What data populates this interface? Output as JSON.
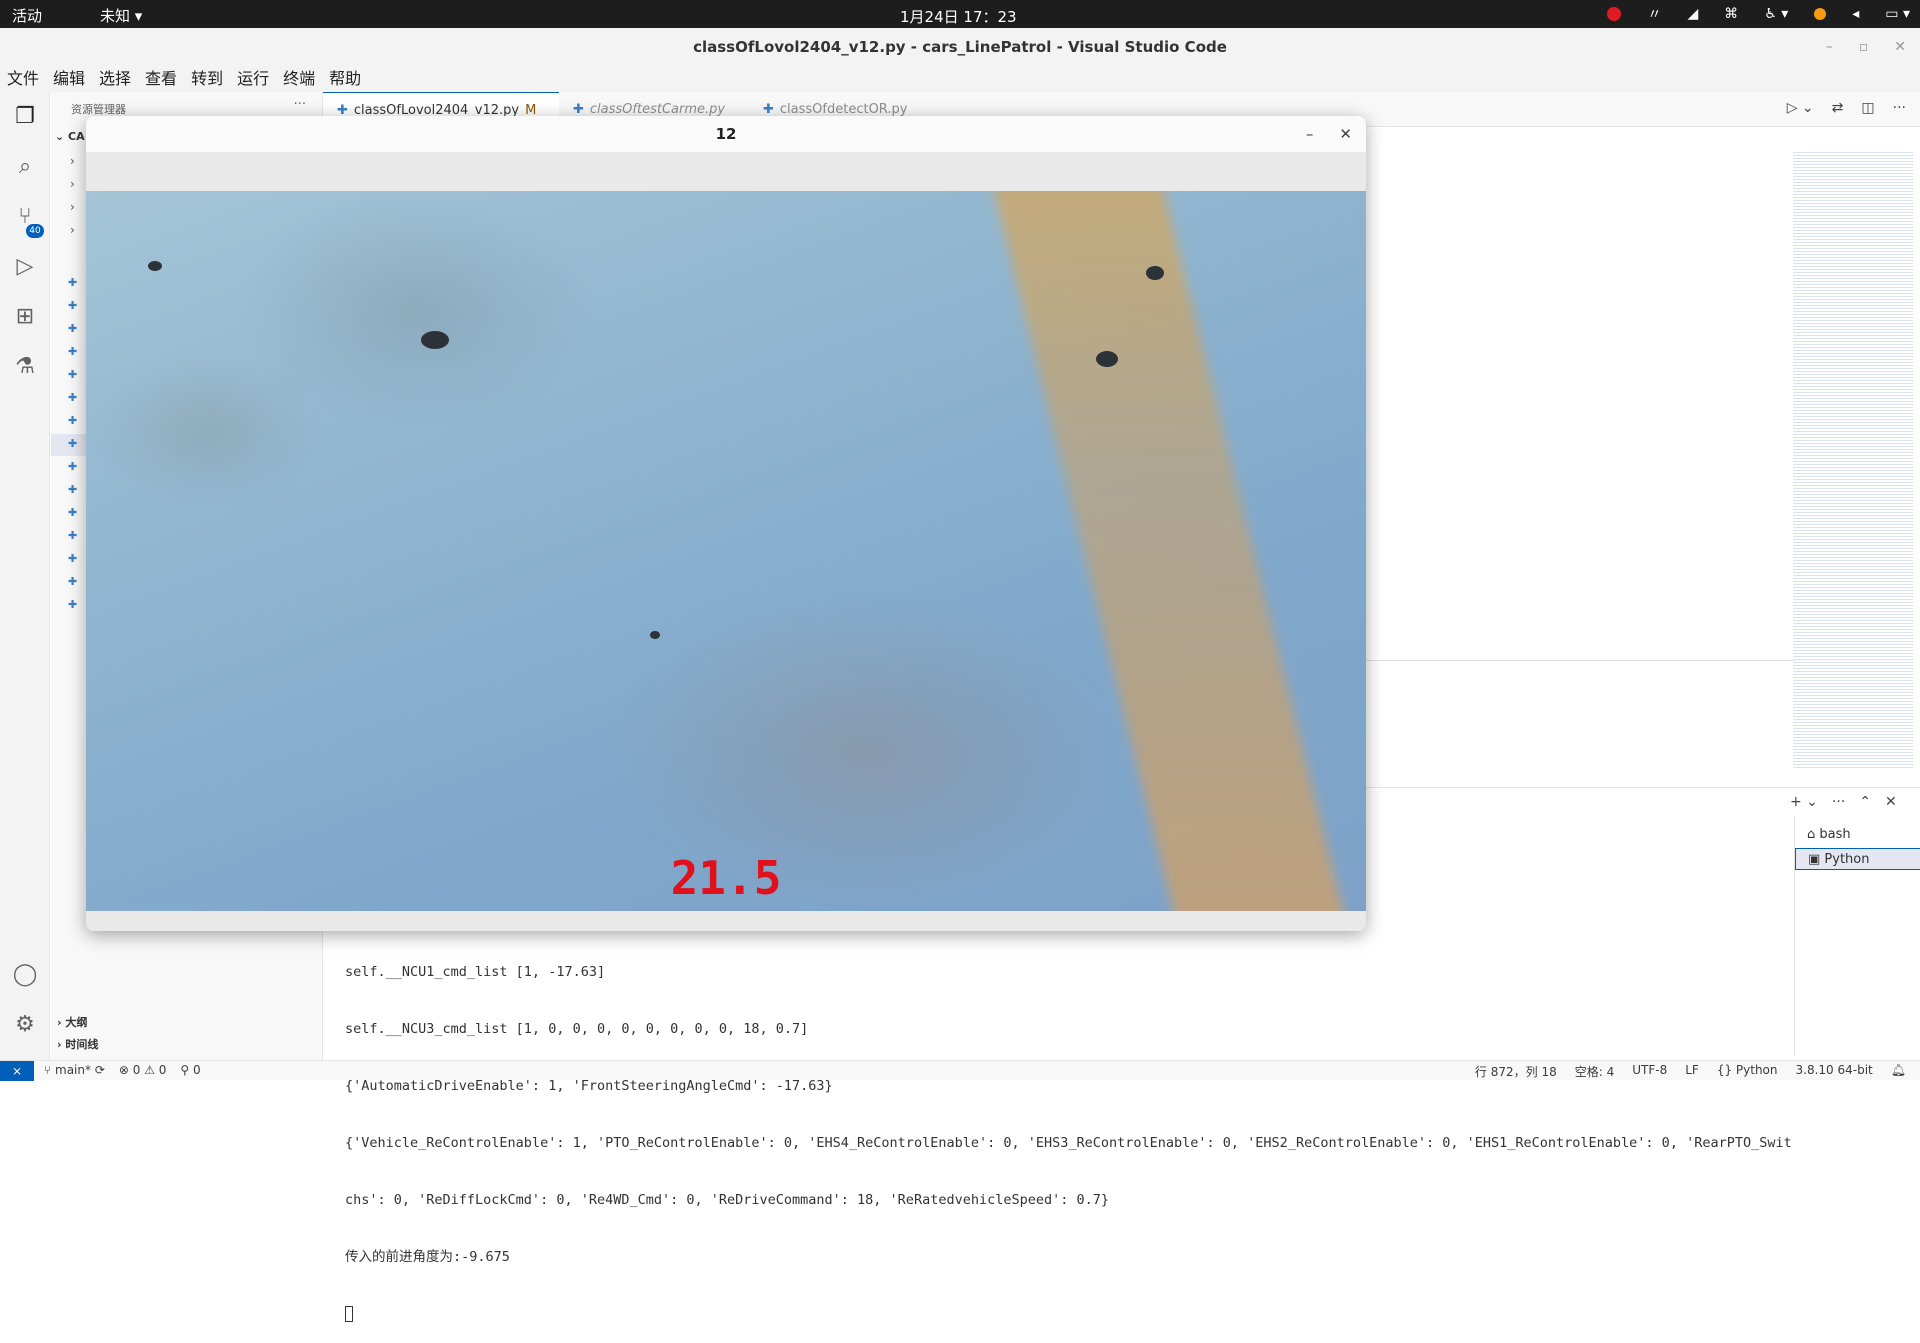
{
  "system_bar": {
    "activities": "活动",
    "app_menu": "未知 ▾",
    "clock": "1月24日  17：23"
  },
  "window": {
    "title": "classOfLovol2404_v12.py - cars_LinePatrol - Visual Studio Code"
  },
  "menu": {
    "items": [
      "文件",
      "编辑",
      "选择",
      "查看",
      "转到",
      "运行",
      "终端",
      "帮助"
    ]
  },
  "activity_bar": {
    "scm_badge": "40"
  },
  "sidebar": {
    "header": "资源管理器",
    "more": "···",
    "root_label": "CA",
    "outline": "大纲",
    "timeline": "时间线"
  },
  "tabs": [
    {
      "label": "classOfLovol2404_v12.py",
      "modified": "M",
      "close": "×"
    },
    {
      "label": "classOftestCarme.py"
    },
    {
      "label": "classOfdetectOR.py"
    }
  ],
  "camera_window": {
    "title": "12",
    "overlay_value": "21.5"
  },
  "terminal": {
    "lines": [
      "self.__NCU1_cmd_list [1, -17.63]",
      "self.__NCU3_cmd_list [1, 0, 0, 0, 0, 0, 0, 0, 0, 18, 0.7]",
      "{'AutomaticDriveEnable': 1, 'FrontSteeringAngleCmd': -17.63}",
      "{'Vehicle_ReControlEnable': 1, 'PTO_ReControlEnable': 0, 'EHS4_ReControlEnable': 0, 'EHS3_ReControlEnable': 0, 'EHS2_ReControlEnable': 0, 'EHS1_ReControlEnable': 0, 'RearPTO_Swit",
      "chs': 0, 'ReDiffLockCmd': 0, 'Re4WD_Cmd': 0, 'ReDriveCommand': 18, 'ReRatedvehicleSpeed': 0.7}",
      "传入的前进角度为:-9.675"
    ],
    "instances": [
      "bash",
      "Python"
    ]
  },
  "status_bar": {
    "branch": "main*",
    "errors": "0",
    "warnings": "0",
    "ports": "0",
    "position": "行 872，列 18",
    "spaces": "空格: 4",
    "encoding": "UTF-8",
    "eol": "LF",
    "language": "Python",
    "interpreter": "3.8.10 64-bit"
  }
}
